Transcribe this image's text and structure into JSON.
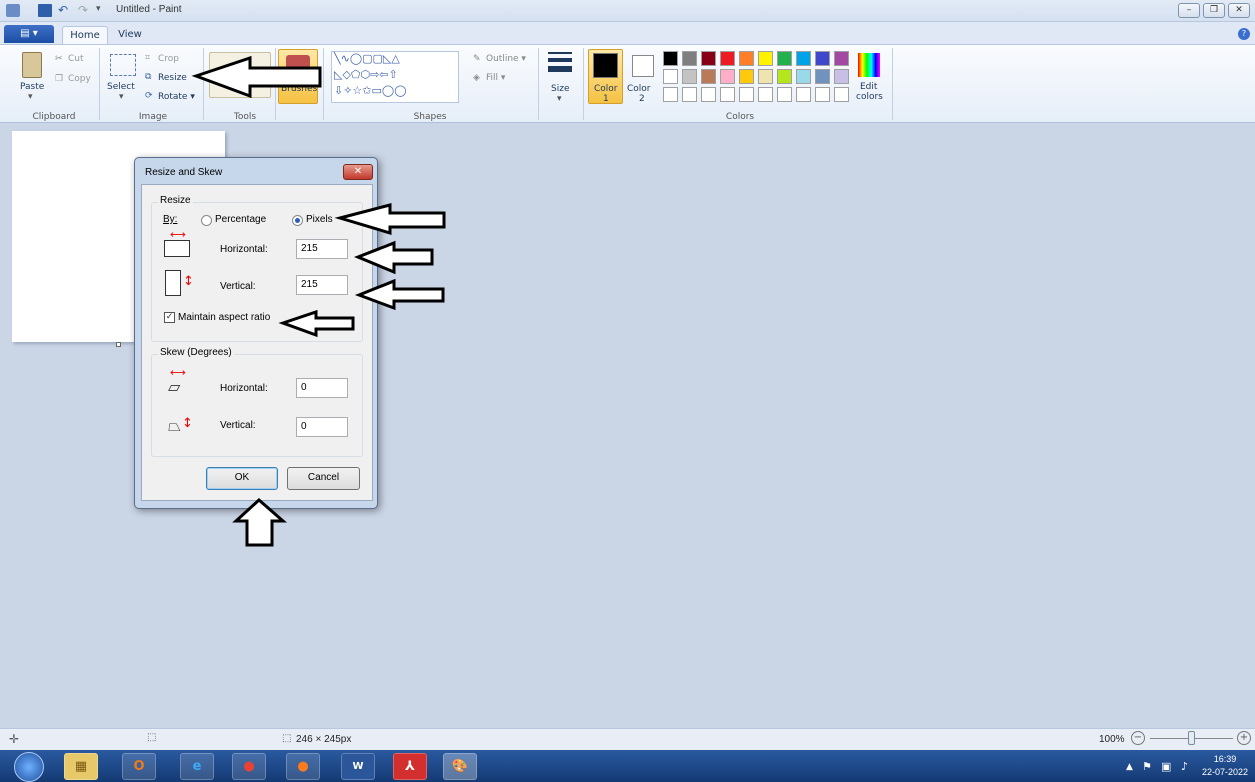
{
  "window": {
    "title": "Untitled - Paint",
    "minimize": "–",
    "restore": "❐",
    "close": "✕"
  },
  "ribbon": {
    "file_menu": "▤ ▾",
    "tabs": [
      "Home",
      "View"
    ],
    "clipboard": {
      "paste": "Paste",
      "cut": "Cut",
      "copy": "Copy",
      "group": "Clipboard"
    },
    "image": {
      "select": "Select",
      "crop": "Crop",
      "resize": "Resize",
      "rotate": "Rotate ▾",
      "group": "Image"
    },
    "tools": {
      "group": "Tools"
    },
    "brushes": {
      "label": "Brushes"
    },
    "shapes": {
      "outline": "Outline ▾",
      "fill": "Fill ▾",
      "group": "Shapes"
    },
    "size": {
      "label": "Size"
    },
    "colors": {
      "color1": "Color",
      "color1_n": "1",
      "color2": "Color",
      "color2_n": "2",
      "edit": "Edit",
      "edit2": "colors",
      "group": "Colors",
      "row1": [
        "#000000",
        "#7f7f7f",
        "#880015",
        "#ed1c24",
        "#ff7f27",
        "#fff200",
        "#22b14c",
        "#00a2e8",
        "#3f48cc",
        "#a349a4"
      ],
      "row2": [
        "#ffffff",
        "#c3c3c3",
        "#b97a57",
        "#ffaec9",
        "#ffc90e",
        "#efe4b0",
        "#b5e61d",
        "#99d9ea",
        "#7092be",
        "#c8bfe7"
      ]
    }
  },
  "dialog": {
    "title": "Resize and Skew",
    "close": "✕",
    "resize": {
      "group": "Resize",
      "by": "By:",
      "percentage": "Percentage",
      "pixels": "Pixels",
      "horizontal_label": "Horizontal:",
      "horizontal_value": "215",
      "vertical_label": "Vertical:",
      "vertical_value": "215",
      "maintain": "Maintain aspect ratio"
    },
    "skew": {
      "group": "Skew (Degrees)",
      "horizontal_label": "Horizontal:",
      "horizontal_value": "0",
      "vertical_label": "Vertical:",
      "vertical_value": "0"
    },
    "ok": "OK",
    "cancel": "Cancel"
  },
  "status": {
    "size": "246 × 245px",
    "zoom": "100%",
    "zoom_level": 1.0
  },
  "taskbar": {
    "time": "16:39",
    "date": "22-07-2022"
  }
}
